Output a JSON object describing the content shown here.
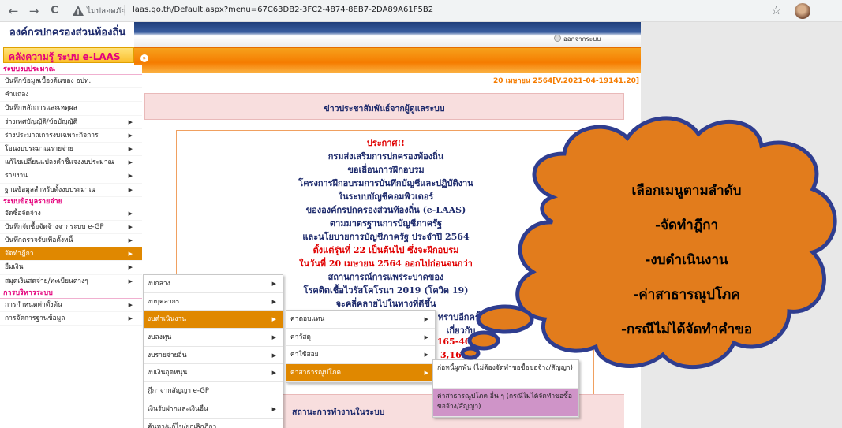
{
  "browser": {
    "insecure_label": "ไม่ปลอดภัย",
    "url": "laas.go.th/Default.aspx?menu=67C63DB2-3FC2-4874-8EB7-2DA89A61F5B2",
    "back": "←",
    "forward": "→",
    "reload": "C",
    "star": "☆"
  },
  "header": {
    "org_title": "องค์กรปกครองส่วนท้องถิ่น",
    "logout": "ออกจากระบบ",
    "knowledge_banner": "คลังความรู้ ระบบ e-LAAS",
    "date_version": "20 เมษายน 2564[V.2021-04-19141.20]"
  },
  "sidebar": {
    "sections": [
      {
        "title": "ระบบงบประมาณ",
        "items": [
          {
            "label": "บันทึกข้อมูลเบื้องต้นของ อปท.",
            "arrow": ""
          },
          {
            "label": "คำแถลง",
            "arrow": ""
          },
          {
            "label": "บันทึกหลักการและเหตุผล",
            "arrow": ""
          },
          {
            "label": "ร่างเทศบัญญัติ/ข้อบัญญัติ",
            "arrow": "▶"
          },
          {
            "label": "ร่างประมาณการงบเฉพาะกิจการ",
            "arrow": "▶"
          },
          {
            "label": "โอนงบประมาณรายจ่าย",
            "arrow": "▶"
          },
          {
            "label": "แก้ไขเปลี่ยนแปลงคำชี้แจงงบประมาณ",
            "arrow": "▶"
          },
          {
            "label": "รายงาน",
            "arrow": "▶"
          },
          {
            "label": "ฐานข้อมูลสำหรับตั้งงบประมาณ",
            "arrow": "▶"
          }
        ]
      },
      {
        "title": "ระบบข้อมูลรายจ่าย",
        "items": [
          {
            "label": "จัดซื้อจัดจ้าง",
            "arrow": "▶"
          },
          {
            "label": "บันทึกจัดซื้อจัดจ้างจากระบบ e-GP",
            "arrow": "▶"
          },
          {
            "label": "บันทึกตรวจรับเพื่อตั้งหนี้",
            "arrow": "▶"
          },
          {
            "label": "จัดทำฎีกา",
            "arrow": "▶",
            "active": true
          },
          {
            "label": "ยืมเงิน",
            "arrow": "▶"
          },
          {
            "label": "สมุดเงินสดจ่าย/ทะเบียนต่างๆ",
            "arrow": "▶"
          }
        ]
      },
      {
        "title": "การบริหารระบบ",
        "items": [
          {
            "label": "การกำหนดค่าตั้งต้น",
            "arrow": "▶"
          },
          {
            "label": "การจัดการฐานข้อมูล",
            "arrow": "▶"
          }
        ]
      }
    ]
  },
  "menus": {
    "level2": [
      {
        "label": "งบกลาง",
        "arrow": "▶"
      },
      {
        "label": "งบบุคลากร",
        "arrow": "▶"
      },
      {
        "label": "งบดำเนินงาน",
        "arrow": "▶",
        "selected": true
      },
      {
        "label": "งบลงทุน",
        "arrow": "▶"
      },
      {
        "label": "งบรายจ่ายอื่น",
        "arrow": "▶"
      },
      {
        "label": "งบเงินอุดหนุน",
        "arrow": "▶"
      },
      {
        "label": "ฎีกาจากสัญญา e-GP",
        "arrow": ""
      },
      {
        "label": "เงินรับฝากและเงินอื่น",
        "arrow": "▶"
      },
      {
        "label": "ค้นหา/แก้ไข/ยกเลิกฎีกา",
        "arrow": ""
      }
    ],
    "level3": [
      {
        "label": "ค่าตอบแทน",
        "arrow": "▶"
      },
      {
        "label": "ค่าวัสดุ",
        "arrow": "▶"
      },
      {
        "label": "ค่าใช้สอย",
        "arrow": "▶"
      },
      {
        "label": "ค่าสาธารณูปโภค",
        "arrow": "▶",
        "selected": true
      }
    ],
    "level4": [
      {
        "label": "ก่อหนี้ผูกพัน (ไม่ต้องจัดทำขอซื้อขอจ้าง/สัญญา)"
      },
      {
        "label": "ค่าสาธารณูปโภค อื่น ๆ (กรณีไม่ได้จัดทำขอซื้อขอจ้าง/สัญญา)",
        "selected": true
      }
    ]
  },
  "content": {
    "news_title": "ข่าวประชาสัมพันธ์จากผู้ดูแลระบบ",
    "announcement": [
      {
        "text": "ประกาศ!!",
        "color": "red"
      },
      {
        "text": "กรมส่งเสริมการปกครองท้องถิ่น",
        "color": "blue"
      },
      {
        "text": "ขอเลื่อนการฝึกอบรม",
        "color": "blue"
      },
      {
        "text": "โครงการฝึกอบรมการบันทึกบัญชีและปฏิบัติงาน",
        "color": "blue"
      },
      {
        "text": "ในระบบบัญชีคอมพิวเตอร์",
        "color": "blue"
      },
      {
        "text": "ขององค์กรปกครองส่วนท้องถิ่น (e-LAAS)",
        "color": "blue"
      },
      {
        "text": "ตามมาตรฐานการบัญชีภาครัฐ",
        "color": "blue"
      },
      {
        "text": "และนโยบายการบัญชีภาครัฐ ประจำปี 2564",
        "color": "blue"
      },
      {
        "text": "ตั้งแต่รุ่นที่ 22 เป็นต้นไป ซึ่งจะฝึกอบรม",
        "color": "red"
      },
      {
        "text": "ในวันที่ 20 เมษายน 2564 ออกไปก่อนจนกว่า",
        "color": "red"
      },
      {
        "text": "สถานการณ์การแพร่ระบาดของ",
        "color": "blue"
      },
      {
        "text": "โรคติดเชื้อไวรัสโคโรนา 2019 (โควิด 19)",
        "color": "blue"
      },
      {
        "text": "จะคลี่คลายไปในทางที่ดีขึ้น",
        "color": "blue"
      },
      {
        "text": "ทราบอีกครั้ง",
        "color": "blue"
      },
      {
        "text": "เกี่ยวกับ",
        "color": "blue"
      },
      {
        "text": "165-402",
        "color": "red"
      },
      {
        "text": "3,1611",
        "color": "red"
      }
    ],
    "status_text": "สถานะการทำงานในระบบ"
  },
  "callout": {
    "lines": [
      "เลือกเมนูตามลำดับ",
      "-จัดทำฎีกา",
      "-งบดำเนินงาน",
      "-ค่าสาธารณูปโภค",
      "-กรณีไม่ได้จัดทำคำขอ"
    ],
    "fill": "#e27c1c",
    "stroke": "#2f3d8f"
  }
}
